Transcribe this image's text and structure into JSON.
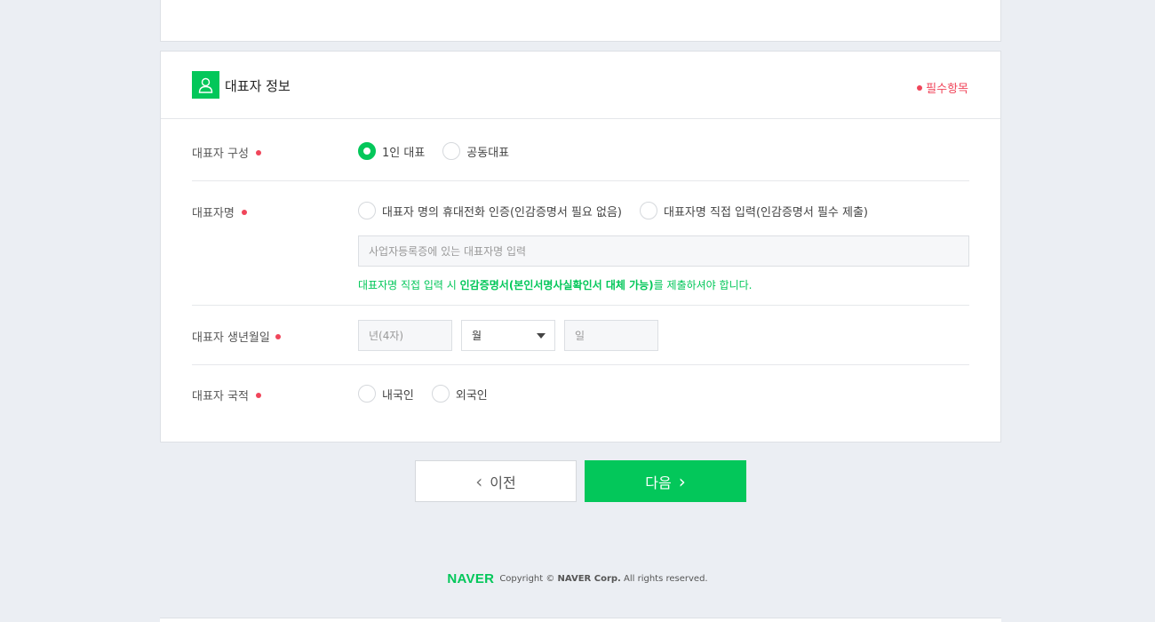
{
  "section": {
    "title": "대표자 정보",
    "required_note": "필수항목"
  },
  "composition": {
    "label": "대표자 구성",
    "options": [
      "1인 대표",
      "공동대표"
    ],
    "selected": "1인 대표"
  },
  "name": {
    "label": "대표자명",
    "options": [
      "대표자 명의 휴대전화 인증(인감증명서 필요 없음)",
      "대표자명 직접 입력(인감증명서 필수 제출)"
    ],
    "input_placeholder": "사업자등록증에 있는 대표자명 입력",
    "notice_prefix": "대표자명 직접 입력 시 ",
    "notice_emphasis": "인감증명서(본인서명사실확인서 대체 가능)",
    "notice_suffix": "를 제출하셔야 합니다."
  },
  "birth": {
    "label": "대표자 생년월일",
    "year_placeholder": "년(4자)",
    "month_value": "월",
    "day_placeholder": "일"
  },
  "nationality": {
    "label": "대표자 국적",
    "options": [
      "내국인",
      "외국인"
    ]
  },
  "buttons": {
    "prev": "이전",
    "next": "다음"
  },
  "footer": {
    "logo": "NAVER",
    "copyright": "Copyright ©",
    "corp": "NAVER Corp.",
    "rights": "All rights reserved."
  },
  "colors": {
    "accent": "#03c75a",
    "required": "#f0455a",
    "background": "#ebeef3"
  }
}
